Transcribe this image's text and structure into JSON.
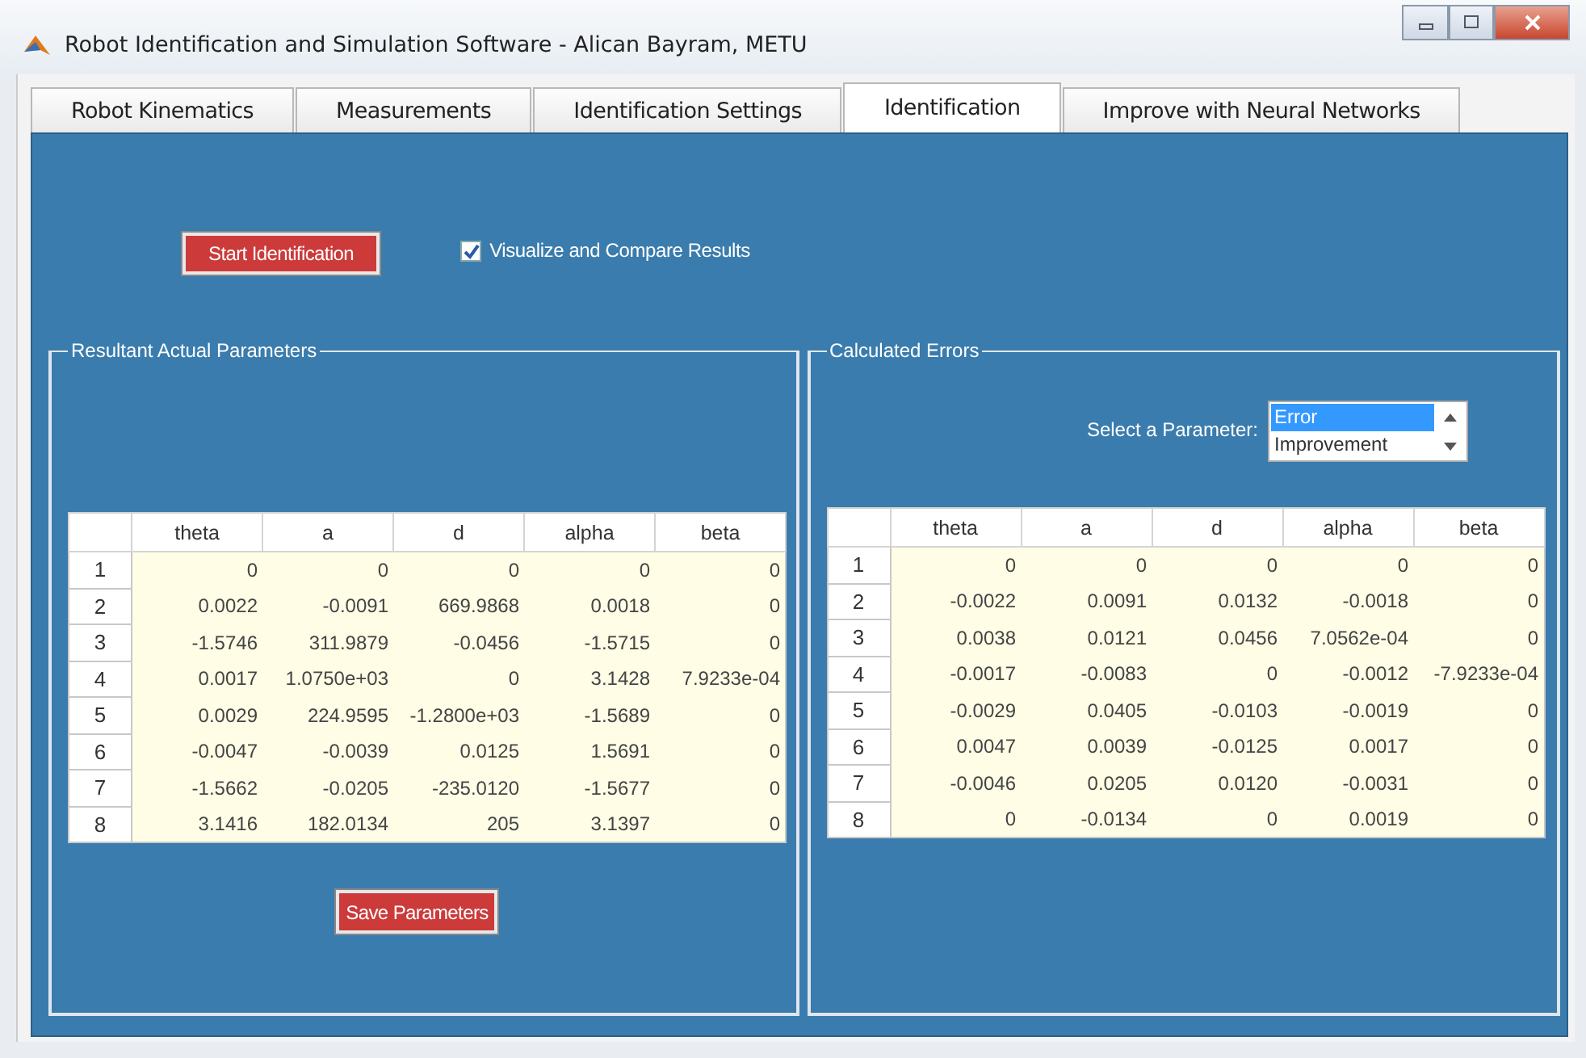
{
  "window": {
    "title": "Robot Identification and Simulation Software - Alican Bayram, METU"
  },
  "tabs": [
    {
      "label": "Robot Kinematics",
      "selected": false
    },
    {
      "label": "Measurements",
      "selected": false
    },
    {
      "label": "Identification Settings",
      "selected": false
    },
    {
      "label": "Identification",
      "selected": true
    },
    {
      "label": "Improve with Neural Networks",
      "selected": false
    }
  ],
  "controls": {
    "start_button": "Start Identification",
    "visualize": {
      "label": "Visualize and Compare Results",
      "checked": true
    }
  },
  "parameters_group": {
    "title": "Resultant Actual Parameters",
    "table": {
      "columns": [
        "theta",
        "a",
        "d",
        "alpha",
        "beta"
      ],
      "rows": [
        {
          "header": "1",
          "cells": [
            "0",
            "0",
            "0",
            "0",
            "0"
          ]
        },
        {
          "header": "2",
          "cells": [
            "0.0022",
            "-0.0091",
            "669.9868",
            "0.0018",
            "0"
          ]
        },
        {
          "header": "3",
          "cells": [
            "-1.5746",
            "311.9879",
            "-0.0456",
            "-1.5715",
            "0"
          ]
        },
        {
          "header": "4",
          "cells": [
            "0.0017",
            "1.0750e+03",
            "0",
            "3.1428",
            "7.9233e-04"
          ]
        },
        {
          "header": "5",
          "cells": [
            "0.0029",
            "224.9595",
            "-1.2800e+03",
            "-1.5689",
            "0"
          ]
        },
        {
          "header": "6",
          "cells": [
            "-0.0047",
            "-0.0039",
            "0.0125",
            "1.5691",
            "0"
          ]
        },
        {
          "header": "7",
          "cells": [
            "-1.5662",
            "-0.0205",
            "-235.0120",
            "-1.5677",
            "0"
          ]
        },
        {
          "header": "8",
          "cells": [
            "3.1416",
            "182.0134",
            "205",
            "3.1397",
            "0"
          ]
        }
      ]
    },
    "save_button": "Save Parameters"
  },
  "errors_group": {
    "title": "Calculated Errors",
    "select_label": "Select a Parameter:",
    "options": [
      {
        "label": "Error",
        "selected": true
      },
      {
        "label": "Improvement",
        "selected": false
      }
    ],
    "table": {
      "columns": [
        "theta",
        "a",
        "d",
        "alpha",
        "beta"
      ],
      "rows": [
        {
          "header": "1",
          "cells": [
            "0",
            "0",
            "0",
            "0",
            "0"
          ]
        },
        {
          "header": "2",
          "cells": [
            "-0.0022",
            "0.0091",
            "0.0132",
            "-0.0018",
            "0"
          ]
        },
        {
          "header": "3",
          "cells": [
            "0.0038",
            "0.0121",
            "0.0456",
            "7.0562e-04",
            "0"
          ]
        },
        {
          "header": "4",
          "cells": [
            "-0.0017",
            "-0.0083",
            "0",
            "-0.0012",
            "-7.9233e-04"
          ]
        },
        {
          "header": "5",
          "cells": [
            "-0.0029",
            "0.0405",
            "-0.0103",
            "-0.0019",
            "0"
          ]
        },
        {
          "header": "6",
          "cells": [
            "0.0047",
            "0.0039",
            "-0.0125",
            "0.0017",
            "0"
          ]
        },
        {
          "header": "7",
          "cells": [
            "-0.0046",
            "0.0205",
            "0.0120",
            "-0.0031",
            "0"
          ]
        },
        {
          "header": "8",
          "cells": [
            "0",
            "-0.0134",
            "0",
            "0.0019",
            "0"
          ]
        }
      ]
    }
  }
}
